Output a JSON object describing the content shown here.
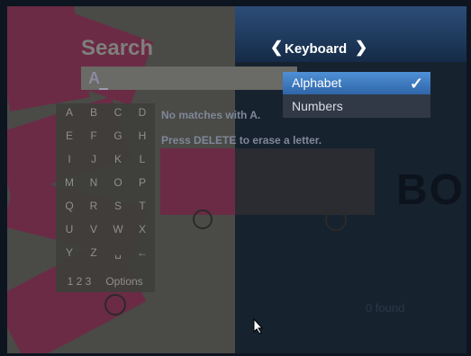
{
  "search": {
    "title": "Search",
    "query": "A"
  },
  "keyboard": {
    "title": "Keyboard",
    "options": [
      "Alphabet",
      "Numbers"
    ],
    "selected": "Alphabet"
  },
  "keypad": {
    "keys": [
      "A",
      "B",
      "C",
      "D",
      "E",
      "F",
      "G",
      "H",
      "I",
      "J",
      "K",
      "L",
      "M",
      "N",
      "O",
      "P",
      "Q",
      "R",
      "S",
      "T",
      "U",
      "V",
      "W",
      "X",
      "Y",
      "Z",
      "␣",
      "←"
    ],
    "numbers_label": "1 2 3",
    "options_label": "Options"
  },
  "messages": {
    "no_matches": "No matches with A.",
    "press_delete": "Press DELETE to erase a letter."
  },
  "results": {
    "found": "0 found",
    "bg_text": "BO"
  }
}
